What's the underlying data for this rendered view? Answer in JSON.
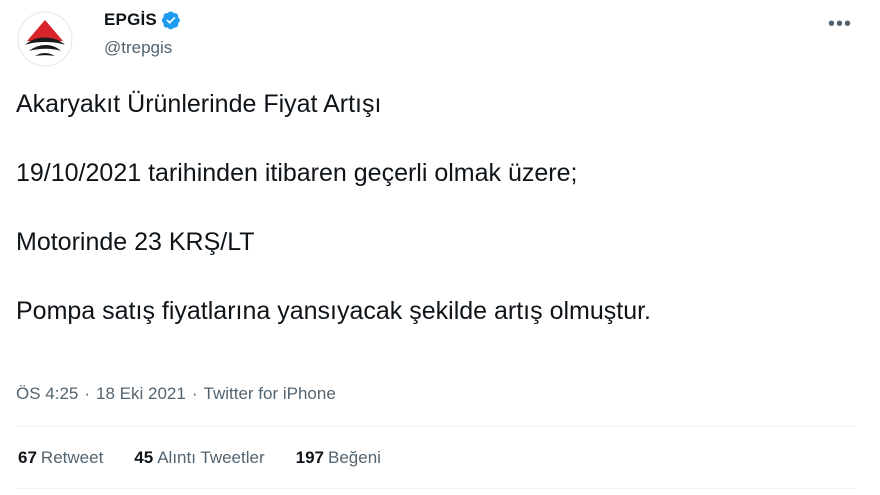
{
  "author": {
    "display_name": "EPGİS",
    "handle": "@trepgis",
    "verified": true,
    "avatar_icon": "epgis-logo-icon"
  },
  "tweet": {
    "lines": [
      "Akaryakıt Ürünlerinde Fiyat Artışı",
      "19/10/2021 tarihinden itibaren geçerli olmak üzere;",
      "Motorinde 23 KRŞ/LT",
      "Pompa satış fiyatlarına yansıyacak şekilde artış olmuştur."
    ]
  },
  "meta": {
    "time": "ÖS 4:25",
    "separator": "·",
    "date": "18 Eki 2021",
    "source": "Twitter for iPhone"
  },
  "stats": [
    {
      "count": "67",
      "label": "Retweet"
    },
    {
      "count": "45",
      "label": "Alıntı Tweetler"
    },
    {
      "count": "197",
      "label": "Beğeni"
    }
  ],
  "colors": {
    "text": "#0f1419",
    "secondary": "#536471",
    "verified": "#1d9bf0",
    "brand_red": "#d7232a"
  }
}
